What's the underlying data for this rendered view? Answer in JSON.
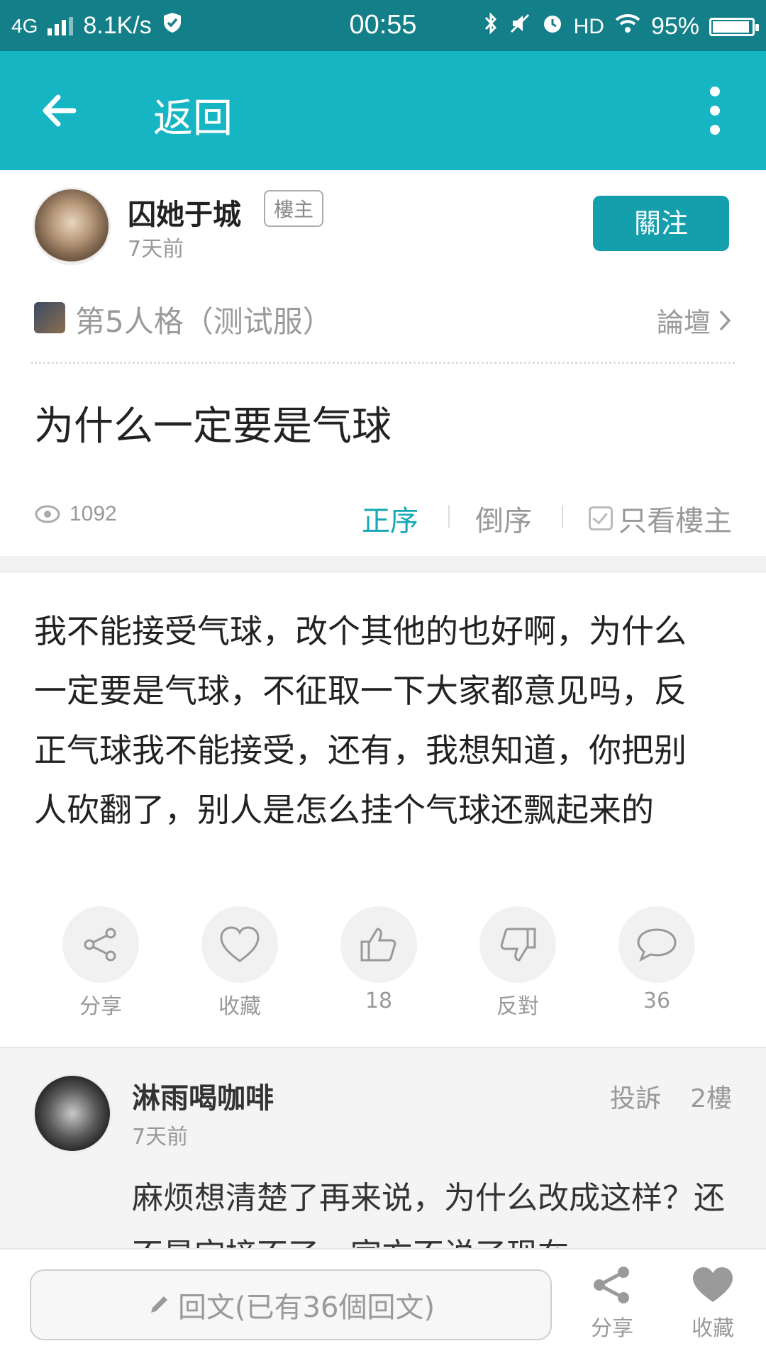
{
  "status_bar": {
    "network": "4G",
    "speed": "8.1K/s",
    "time": "00:55",
    "hd": "HD",
    "battery_percent": "95%",
    "battery_level": 0.95
  },
  "app_bar": {
    "title": "返回",
    "icons": {
      "back": "arrow-left-icon",
      "more": "more-vertical-icon"
    }
  },
  "author": {
    "name": "囚她于城",
    "badge": "樓主",
    "time": "7天前",
    "follow_label": "關注"
  },
  "forum": {
    "name": "第5人格（测试服）",
    "link_label": "論壇"
  },
  "post": {
    "title": "为什么一定要是气球",
    "views": "1092",
    "sort_asc": "正序",
    "sort_desc": "倒序",
    "only_owner": "只看樓主",
    "body": "我不能接受气球，改个其他的也好啊，为什么一定要是气球，不征取一下大家都意见吗，反正气球我不能接受，还有，我想知道，你把别人砍翻了，别人是怎么挂个气球还飘起来的"
  },
  "actions": [
    {
      "label": "分享",
      "icon": "share-icon"
    },
    {
      "label": "收藏",
      "icon": "heart-icon"
    },
    {
      "label": "18",
      "icon": "thumbs-up-icon"
    },
    {
      "label": "反對",
      "icon": "thumbs-down-icon"
    },
    {
      "label": "36",
      "icon": "comment-icon"
    }
  ],
  "reply": {
    "name": "淋雨喝咖啡",
    "time": "7天前",
    "report": "投訴",
    "floor": "2樓",
    "content": "麻烦想清楚了再来说，为什么改成这样？还不是宝接不了，官方不说了现在"
  },
  "bottom_bar": {
    "reply_placeholder": "回文(已有36個回文)",
    "share_label": "分享",
    "fav_label": "收藏"
  },
  "colors": {
    "status_bar": "#137f89",
    "app_bar": "#15b5c3",
    "accent": "#15a8b6",
    "follow_button": "#159fad"
  }
}
